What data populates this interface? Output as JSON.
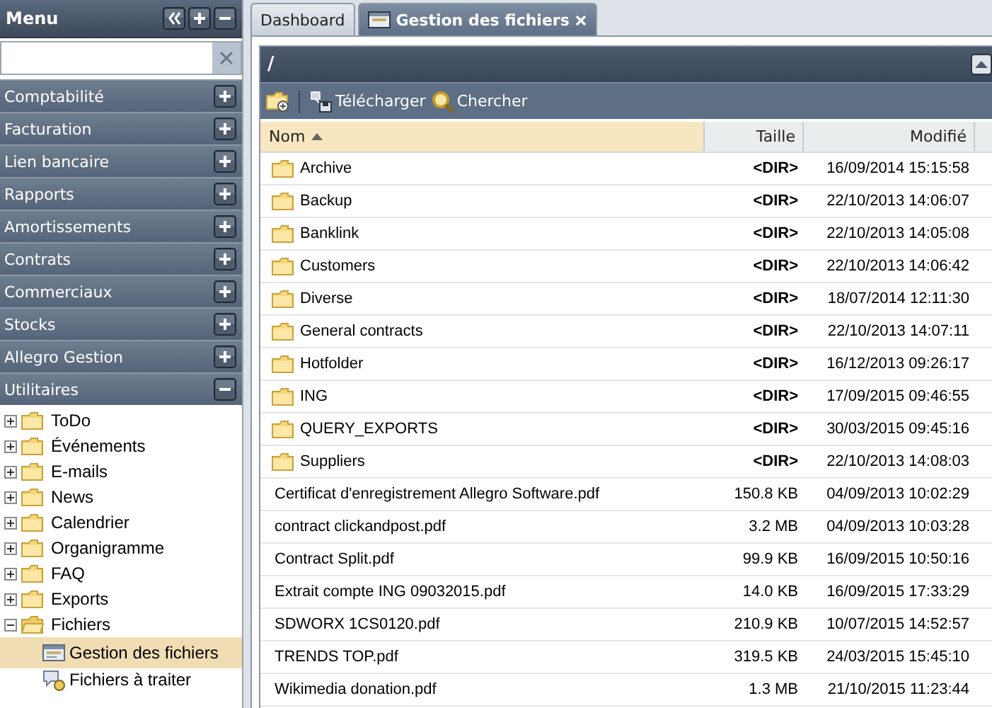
{
  "sidebar": {
    "title": "Menu",
    "sections": [
      {
        "label": "Comptabilité",
        "expanded": false
      },
      {
        "label": "Facturation",
        "expanded": false
      },
      {
        "label": "Lien bancaire",
        "expanded": false
      },
      {
        "label": "Rapports",
        "expanded": false
      },
      {
        "label": "Amortissements",
        "expanded": false
      },
      {
        "label": "Contrats",
        "expanded": false
      },
      {
        "label": "Commerciaux",
        "expanded": false
      },
      {
        "label": "Stocks",
        "expanded": false
      },
      {
        "label": "Allegro Gestion",
        "expanded": false
      },
      {
        "label": "Utilitaires",
        "expanded": true
      }
    ],
    "tree": [
      {
        "label": "ToDo",
        "expanded": false
      },
      {
        "label": "Événements",
        "expanded": false
      },
      {
        "label": "E-mails",
        "expanded": false
      },
      {
        "label": "News",
        "expanded": false
      },
      {
        "label": "Calendrier",
        "expanded": false
      },
      {
        "label": "Organigramme",
        "expanded": false
      },
      {
        "label": "FAQ",
        "expanded": false
      },
      {
        "label": "Exports",
        "expanded": false
      },
      {
        "label": "Fichiers",
        "expanded": true,
        "children": [
          {
            "label": "Gestion des fichiers",
            "kind": "window",
            "selected": true
          },
          {
            "label": "Fichiers à traiter",
            "kind": "inbox",
            "selected": false
          }
        ]
      }
    ]
  },
  "tabs": [
    {
      "label": "Dashboard",
      "selected": false,
      "closable": false
    },
    {
      "label": "Gestion des fichiers",
      "selected": true,
      "closable": true
    }
  ],
  "panel": {
    "title": "/",
    "toolbar": [
      {
        "kind": "new-folder"
      },
      {
        "kind": "download",
        "label": "Télécharger"
      },
      {
        "kind": "search",
        "label": "Chercher"
      }
    ],
    "columns": [
      {
        "label": "Nom",
        "sorted": true
      },
      {
        "label": "Taille",
        "sorted": false
      },
      {
        "label": "Modifié",
        "sorted": false
      }
    ],
    "rows": [
      {
        "kind": "folder",
        "name": "Archive",
        "size": "<DIR>",
        "modified": "16/09/2014 15:15:58"
      },
      {
        "kind": "folder",
        "name": "Backup",
        "size": "<DIR>",
        "modified": "22/10/2013 14:06:07"
      },
      {
        "kind": "folder",
        "name": "Banklink",
        "size": "<DIR>",
        "modified": "22/10/2013 14:05:08"
      },
      {
        "kind": "folder",
        "name": "Customers",
        "size": "<DIR>",
        "modified": "22/10/2013 14:06:42"
      },
      {
        "kind": "folder",
        "name": "Diverse",
        "size": "<DIR>",
        "modified": "18/07/2014 12:11:30"
      },
      {
        "kind": "folder",
        "name": "General contracts",
        "size": "<DIR>",
        "modified": "22/10/2013 14:07:11"
      },
      {
        "kind": "folder",
        "name": "Hotfolder",
        "size": "<DIR>",
        "modified": "16/12/2013 09:26:17"
      },
      {
        "kind": "folder",
        "name": "ING",
        "size": "<DIR>",
        "modified": "17/09/2015 09:46:55"
      },
      {
        "kind": "folder",
        "name": "QUERY_EXPORTS",
        "size": "<DIR>",
        "modified": "30/03/2015 09:45:16"
      },
      {
        "kind": "folder",
        "name": "Suppliers",
        "size": "<DIR>",
        "modified": "22/10/2013 14:08:03"
      },
      {
        "kind": "file",
        "name": "Certificat d'enregistrement Allegro Software.pdf",
        "size": "150.8 KB",
        "modified": "04/09/2013 10:02:29"
      },
      {
        "kind": "file",
        "name": "contract clickandpost.pdf",
        "size": "3.2 MB",
        "modified": "04/09/2013 10:03:28"
      },
      {
        "kind": "file",
        "name": "Contract Split.pdf",
        "size": "99.9 KB",
        "modified": "16/09/2015 10:50:16"
      },
      {
        "kind": "file",
        "name": "Extrait compte ING 09032015.pdf",
        "size": "14.0 KB",
        "modified": "16/09/2015 17:33:29"
      },
      {
        "kind": "file",
        "name": "SDWORX 1CS0120.pdf",
        "size": "210.9 KB",
        "modified": "10/07/2015 14:52:57"
      },
      {
        "kind": "file",
        "name": "TRENDS TOP.pdf",
        "size": "319.5 KB",
        "modified": "24/03/2015 15:45:10"
      },
      {
        "kind": "file",
        "name": "Wikimedia donation.pdf",
        "size": "1.3 MB",
        "modified": "21/10/2015 11:23:44"
      }
    ]
  }
}
